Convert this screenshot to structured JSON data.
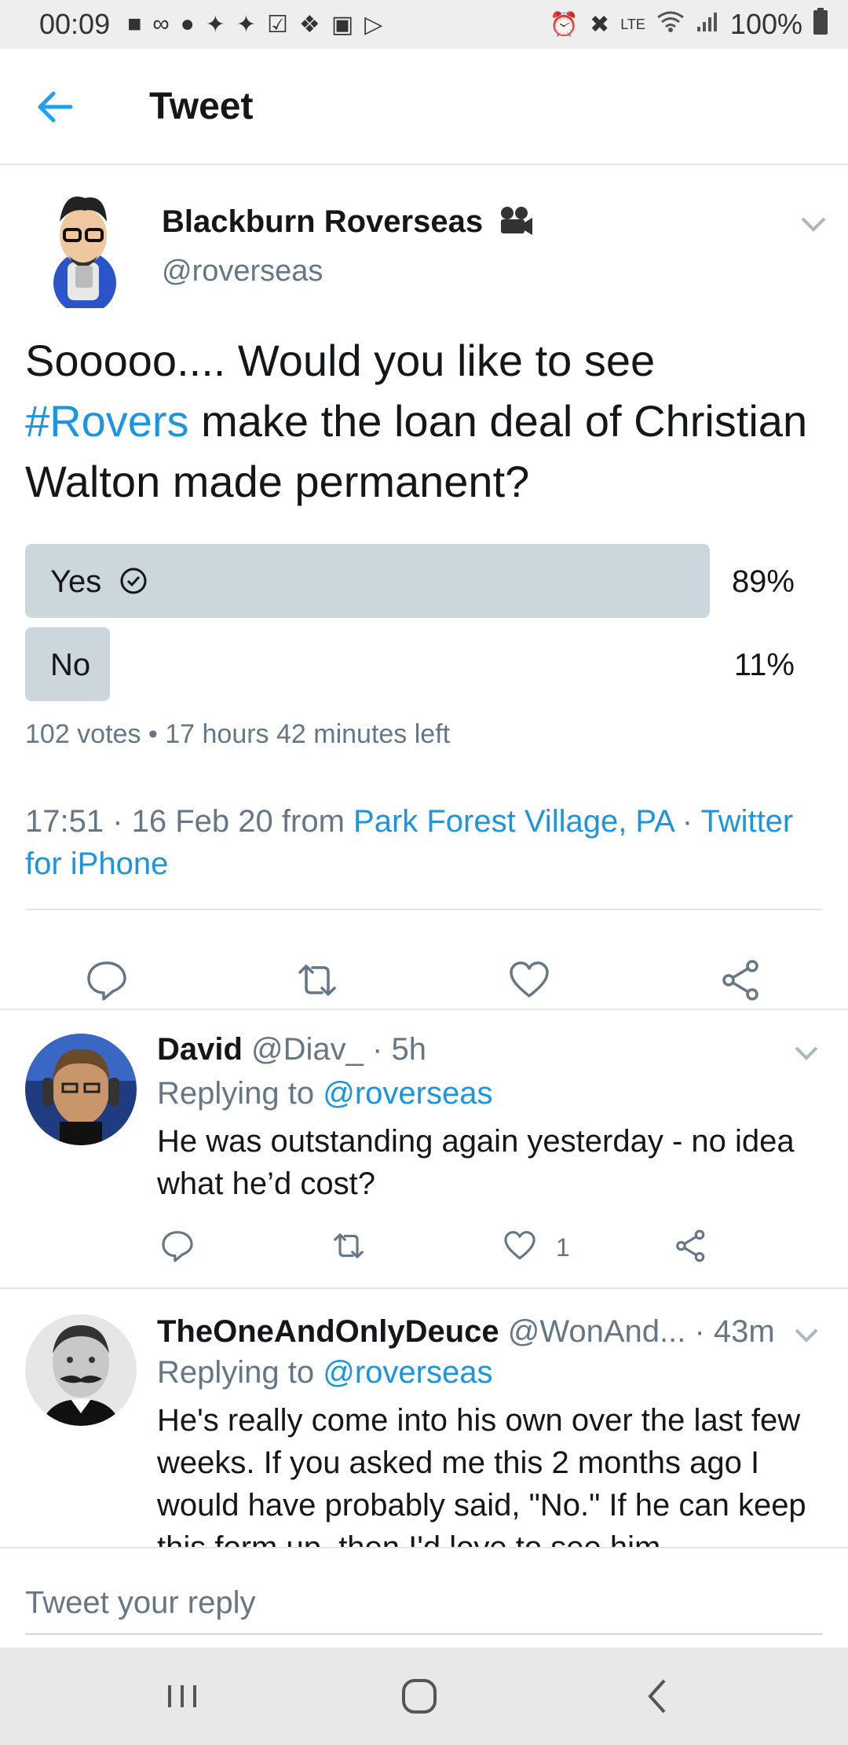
{
  "status_bar": {
    "time": "00:09",
    "battery": "100%",
    "volte_label": "LTE"
  },
  "header": {
    "title": "Tweet"
  },
  "tweet": {
    "author_name": "Blackburn Roverseas",
    "handle": "@roverseas",
    "text_before": "Sooooo.... Would you like to see ",
    "hashtag": "#Rovers",
    "text_after": " make the loan deal of Christian Walton made permanent?",
    "poll": {
      "options": [
        {
          "label": "Yes",
          "percent_text": "89%",
          "fraction": 0.89,
          "winner": true
        },
        {
          "label": "No",
          "percent_text": "11%",
          "fraction": 0.11,
          "winner": false
        }
      ],
      "meta": "102 votes • 17 hours 42 minutes left"
    },
    "timestamp": "17:51 · 16 Feb 20 from ",
    "location": "Park Forest Village, PA",
    "separator": " · ",
    "client": "Twitter for iPhone"
  },
  "replies": [
    {
      "name": "David",
      "handle_meta": " @Diav_ · 5h",
      "replying_prefix": "Replying to ",
      "replying_to": "@roverseas",
      "text": "He was outstanding again yesterday - no idea what he’d cost?",
      "like_count": "1"
    },
    {
      "name": "TheOneAndOnlyDeuce",
      "handle_meta": " @WonAnd... · 43m",
      "replying_prefix": "Replying to ",
      "replying_to": "@roverseas",
      "text": "He's really come into his own over the last few weeks. If you asked me this 2 months ago I would have probably said, \"No.\" If he can keep this form up, then I'd love to see him"
    }
  ],
  "composer": {
    "placeholder": "Tweet your reply"
  },
  "colors": {
    "accent": "#1b95e0",
    "secondary_text": "#657786",
    "poll_bar": "#ccd6dd"
  }
}
